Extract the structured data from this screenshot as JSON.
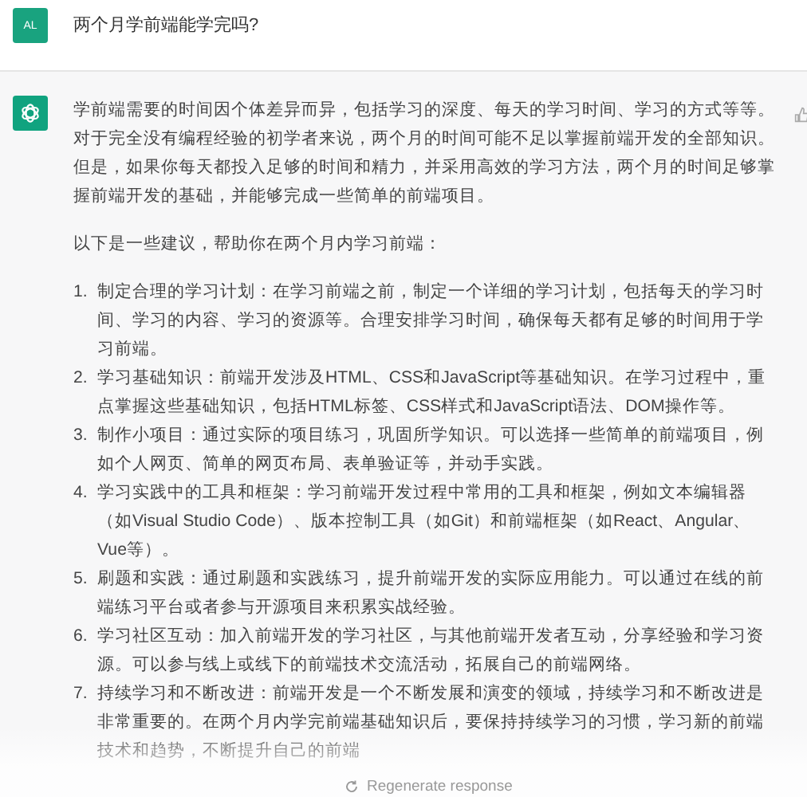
{
  "user_message": {
    "avatar": "AL",
    "text": "两个月学前端能学完吗?"
  },
  "assistant_message": {
    "paragraphs": [
      "学前端需要的时间因个体差异而异，包括学习的深度、每天的学习时间、学习的方式等等。对于完全没有编程经验的初学者来说，两个月的时间可能不足以掌握前端开发的全部知识。但是，如果你每天都投入足够的时间和精力，并采用高效的学习方法，两个月的时间足够掌握前端开发的基础，并能够完成一些简单的前端项目。",
      "以下是一些建议，帮助你在两个月内学习前端："
    ],
    "list": [
      {
        "number": "1.",
        "text": "制定合理的学习计划：在学习前端之前，制定一个详细的学习计划，包括每天的学习时间、学习的内容、学习的资源等。合理安排学习时间，确保每天都有足够的时间用于学习前端。"
      },
      {
        "number": "2.",
        "text": "学习基础知识：前端开发涉及HTML、CSS和JavaScript等基础知识。在学习过程中，重点掌握这些基础知识，包括HTML标签、CSS样式和JavaScript语法、DOM操作等。"
      },
      {
        "number": "3.",
        "text": "制作小项目：通过实际的项目练习，巩固所学知识。可以选择一些简单的前端项目，例如个人网页、简单的网页布局、表单验证等，并动手实践。"
      },
      {
        "number": "4.",
        "text": "学习实践中的工具和框架：学习前端开发过程中常用的工具和框架，例如文本编辑器（如Visual Studio Code）、版本控制工具（如Git）和前端框架（如React、Angular、Vue等）。"
      },
      {
        "number": "5.",
        "text": "刷题和实践：通过刷题和实践练习，提升前端开发的实际应用能力。可以通过在线的前端练习平台或者参与开源项目来积累实战经验。"
      },
      {
        "number": "6.",
        "text": "学习社区互动：加入前端开发的学习社区，与其他前端开发者互动，分享经验和学习资源。可以参与线上或线下的前端技术交流活动，拓展自己的前端网络。"
      },
      {
        "number": "7.",
        "text": "持续学习和不断改进：前端开发是一个不断发展和演变的领域，持续学习和不断改进是非常重要的。在两个月内学完前端基础知识后，要保持持续学习的习惯，学习新的前端技术和趋势，不断提升自己的前端"
      }
    ]
  },
  "regenerate_button": {
    "label": "Regenerate response"
  }
}
